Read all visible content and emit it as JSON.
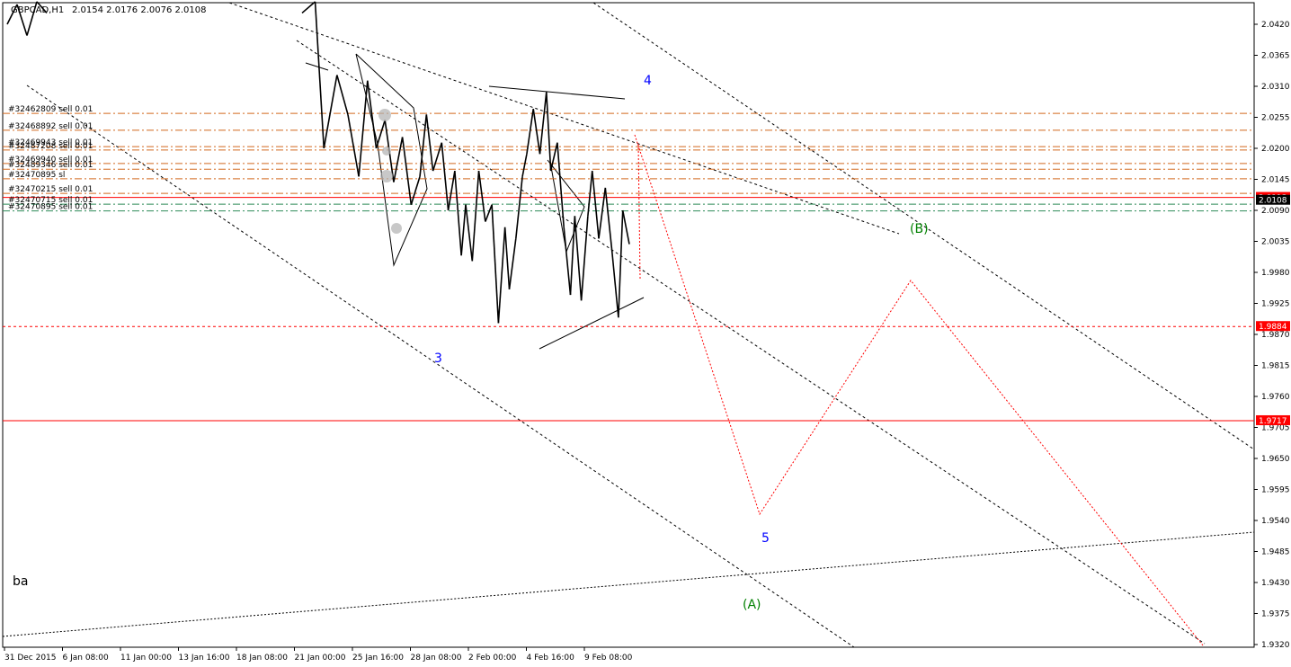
{
  "header": {
    "symbol": "GBPCAD,H1",
    "values": "2.0154 2.0176 2.0076 2.0108"
  },
  "chart_data": {
    "type": "candlestick",
    "symbol": "GBPCAD",
    "timeframe": "H1",
    "ohlc_last": {
      "open": 2.0154,
      "high": 2.0176,
      "low": 2.0076,
      "close": 2.0108
    },
    "ylim": [
      1.932,
      2.0475
    ],
    "y_ticks": [
      "2.0420",
      "2.0365",
      "2.0310",
      "2.0255",
      "2.0200",
      "2.0145",
      "2.0090",
      "2.0035",
      "1.9980",
      "1.9925",
      "1.9870",
      "1.9815",
      "1.9760",
      "1.9705",
      "1.9650",
      "1.9595",
      "1.9540",
      "1.9485",
      "1.9430",
      "1.9375",
      "1.9320"
    ],
    "x_ticks": [
      "31 Dec 2015",
      "6 Jan 08:00",
      "11 Jan 00:00",
      "13 Jan 16:00",
      "18 Jan 08:00",
      "21 Jan 00:00",
      "25 Jan 16:00",
      "28 Jan 08:00",
      "2 Feb 00:00",
      "4 Feb 16:00",
      "9 Feb 08:00"
    ],
    "price_path": [
      [
        0.0,
        2.042
      ],
      [
        0.03,
        2.0455
      ],
      [
        0.06,
        2.04
      ],
      [
        0.09,
        2.046
      ],
      [
        0.12,
        2.044
      ],
      [
        0.25,
        2.044
      ],
      [
        0.28,
        2.046
      ],
      [
        0.3,
        2.02
      ],
      [
        0.33,
        2.033
      ],
      [
        0.355,
        2.026
      ],
      [
        0.38,
        2.015
      ],
      [
        0.4,
        2.032
      ],
      [
        0.42,
        2.02
      ],
      [
        0.44,
        2.025
      ],
      [
        0.46,
        2.014
      ],
      [
        0.48,
        2.022
      ],
      [
        0.5,
        2.01
      ],
      [
        0.52,
        2.015
      ],
      [
        0.535,
        2.026
      ],
      [
        0.55,
        2.016
      ],
      [
        0.57,
        2.021
      ],
      [
        0.585,
        2.009
      ],
      [
        0.6,
        2.016
      ],
      [
        0.615,
        2.001
      ],
      [
        0.625,
        2.01
      ],
      [
        0.64,
        2.0
      ],
      [
        0.655,
        2.016
      ],
      [
        0.67,
        2.007
      ],
      [
        0.685,
        2.01
      ],
      [
        0.7,
        1.989
      ],
      [
        0.715,
        2.006
      ],
      [
        0.725,
        1.995
      ],
      [
        0.74,
        2.004
      ],
      [
        0.755,
        2.015
      ],
      [
        0.765,
        2.019
      ],
      [
        0.78,
        2.027
      ],
      [
        0.795,
        2.019
      ],
      [
        0.81,
        2.03
      ],
      [
        0.82,
        2.016
      ],
      [
        0.835,
        2.021
      ],
      [
        0.85,
        2.006
      ],
      [
        0.865,
        1.994
      ],
      [
        0.875,
        2.008
      ],
      [
        0.89,
        1.993
      ],
      [
        0.905,
        2.008
      ],
      [
        0.915,
        2.016
      ],
      [
        0.93,
        2.004
      ],
      [
        0.945,
        2.013
      ],
      [
        0.96,
        2.002
      ],
      [
        0.975,
        1.99
      ],
      [
        0.985,
        2.009
      ],
      [
        1.0,
        2.003
      ]
    ],
    "horizontal_levels": [
      {
        "label": "#32462809 sell 0.01",
        "price": 2.0262,
        "color": "#d2691e",
        "style": "dashdot"
      },
      {
        "label": "#32468892 sell 0.01",
        "price": 2.0232,
        "color": "#d2691e",
        "style": "dashdot"
      },
      {
        "label": "#32469943 sell 0.01",
        "price": 2.0203,
        "color": "#d2691e",
        "style": "dashdot"
      },
      {
        "label": "#32487208 sell 0.01",
        "price": 2.0197,
        "color": "#d2691e",
        "style": "dashdot"
      },
      {
        "label": "#32469940 sell 0.01",
        "price": 2.0173,
        "color": "#d2691e",
        "style": "dashdot"
      },
      {
        "label": "#32489346 sell 0.01",
        "price": 2.0163,
        "color": "#d2691e",
        "style": "dashdot"
      },
      {
        "label": "#32470895 sl",
        "price": 2.0146,
        "color": "#d2691e",
        "style": "dashdot"
      },
      {
        "label": "#32470215 sell 0.01",
        "price": 2.012,
        "color": "#d2691e",
        "style": "dashdot"
      },
      {
        "label": "#32470715 sell 0.01",
        "price": 2.0101,
        "color": "#2e8b57",
        "style": "dashdot"
      },
      {
        "label": "#32470895 sell 0.01",
        "price": 2.0089,
        "color": "#2e8b57",
        "style": "dashdot"
      },
      {
        "label": "",
        "price": 2.0113,
        "color": "#ff0000",
        "style": "solid"
      },
      {
        "label": "",
        "price": 1.9884,
        "color": "#ff0000",
        "style": "dashed"
      },
      {
        "label": "",
        "price": 1.9717,
        "color": "#ff0000",
        "style": "solid"
      }
    ],
    "price_badges": [
      {
        "text": "2.0113",
        "bg": "#ff0000",
        "fg": "#ffffff"
      },
      {
        "text": "2.0108",
        "bg": "#000000",
        "fg": "#ffffff"
      },
      {
        "text": "1.9884",
        "bg": "#ff0000",
        "fg": "#ffffff"
      },
      {
        "text": "1.9717",
        "bg": "#ff0000",
        "fg": "#ffffff"
      }
    ],
    "wave_labels": [
      {
        "text": "3",
        "color": "#0000ff"
      },
      {
        "text": "4",
        "color": "#0000ff"
      },
      {
        "text": "5",
        "color": "#0000ff"
      },
      {
        "text": "(A)",
        "color": "#008000"
      },
      {
        "text": "(B)",
        "color": "#008000"
      }
    ],
    "note_text": "ba",
    "grid": false,
    "legend": "none"
  }
}
